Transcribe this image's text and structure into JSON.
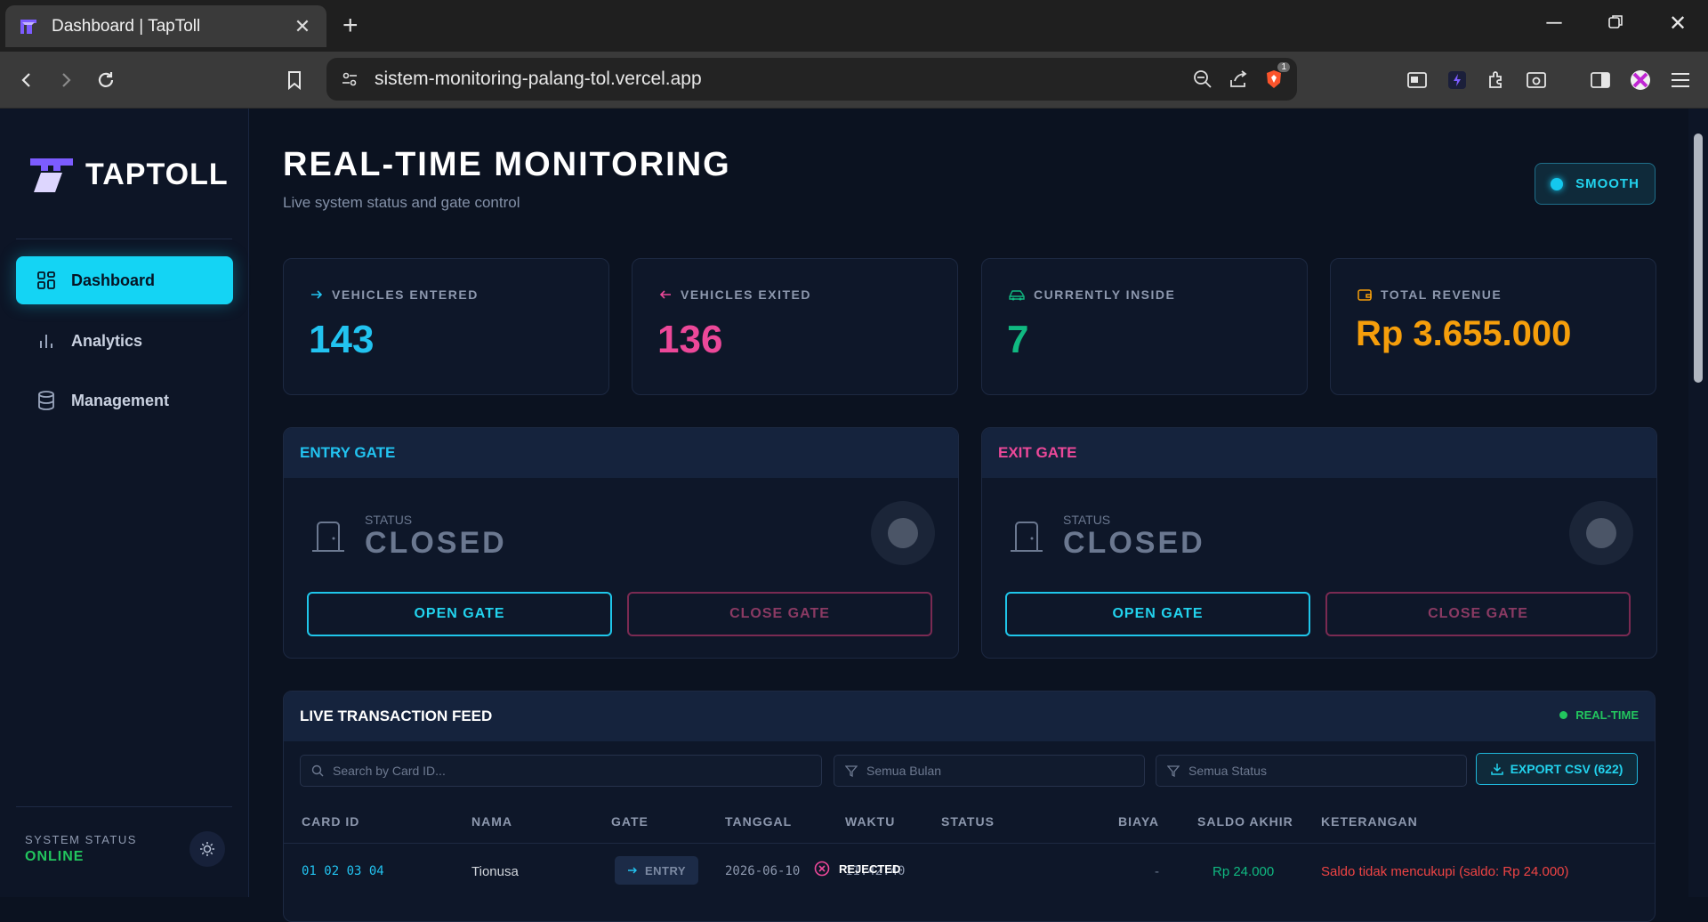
{
  "browser": {
    "tab_title": "Dashboard | TapToll",
    "url": "sistem-monitoring-palang-tol.vercel.app",
    "brave_badge": "1"
  },
  "sidebar": {
    "brand": "TAPTOLL",
    "items": [
      {
        "label": "Dashboard",
        "icon": "grid-icon",
        "active": true
      },
      {
        "label": "Analytics",
        "icon": "bar-chart-icon",
        "active": false
      },
      {
        "label": "Management",
        "icon": "database-icon",
        "active": false
      }
    ],
    "system_status_label": "SYSTEM STATUS",
    "system_status_value": "ONLINE"
  },
  "header": {
    "title": "REAL-TIME MONITORING",
    "subtitle": "Live system status and gate control",
    "mode_badge": "SMOOTH"
  },
  "stats": [
    {
      "label": "VEHICLES ENTERED",
      "value": "143",
      "color": "#22c3f0",
      "icon": "arrow-right-icon"
    },
    {
      "label": "VEHICLES EXITED",
      "value": "136",
      "color": "#ec4899",
      "icon": "arrow-left-icon"
    },
    {
      "label": "CURRENTLY INSIDE",
      "value": "7",
      "color": "#10b981",
      "icon": "car-icon"
    },
    {
      "label": "TOTAL REVENUE",
      "value": "Rp 3.655.000",
      "color": "#f59e0b",
      "icon": "wallet-icon"
    }
  ],
  "gates": {
    "entry": {
      "title": "ENTRY GATE",
      "status_label": "STATUS",
      "status": "CLOSED",
      "open_label": "OPEN GATE",
      "close_label": "CLOSE GATE",
      "title_color": "#22c3f0"
    },
    "exit": {
      "title": "EXIT GATE",
      "status_label": "STATUS",
      "status": "CLOSED",
      "open_label": "OPEN GATE",
      "close_label": "CLOSE GATE",
      "title_color": "#ec4899"
    }
  },
  "feed": {
    "title": "LIVE TRANSACTION FEED",
    "realtime_label": "REAL-TIME",
    "search_placeholder": "Search by Card ID...",
    "month_filter": "Semua Bulan",
    "status_filter": "Semua Status",
    "export_label": "EXPORT CSV (622)",
    "columns": [
      "CARD ID",
      "NAMA",
      "GATE",
      "TANGGAL",
      "WAKTU",
      "STATUS",
      "BIAYA",
      "SALDO AKHIR",
      "KETERANGAN"
    ],
    "rows": [
      {
        "card_id": "01 02 03 04",
        "nama": "Tionusa",
        "gate": "ENTRY",
        "tanggal": "2026-06-10",
        "waktu": "11:42:40",
        "status": "REJECTED",
        "biaya": "-",
        "saldo_akhir": "Rp 24.000",
        "keterangan": "Saldo tidak mencukupi (saldo: Rp 24.000)"
      }
    ]
  }
}
